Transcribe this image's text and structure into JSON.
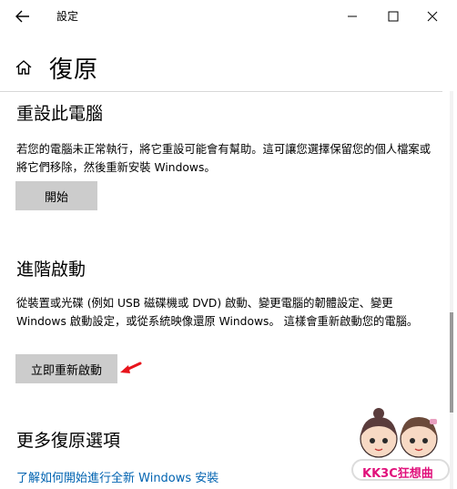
{
  "window": {
    "title": "設定",
    "controls": {
      "minimize": "minimize-icon",
      "maximize": "maximize-icon",
      "close": "close-icon"
    }
  },
  "header": {
    "title": "復原",
    "icon": "home-icon"
  },
  "sections": [
    {
      "title": "重設此電腦",
      "description": "若您的電腦未正常執行，將它重設可能會有幫助。這可讓您選擇保留您的個人檔案或將它們移除，然後重新安裝 Windows。",
      "button": "開始"
    },
    {
      "title": "進階啟動",
      "description": "從裝置或光碟 (例如 USB 磁碟機或 DVD) 啟動、變更電腦的韌體設定、變更 Windows 啟動設定，或從系統映像還原 Windows。 這樣會重新啟動您的電腦。",
      "button": "立即重新啟動"
    },
    {
      "title": "更多復原選項",
      "link": "了解如何開始進行全新 Windows 安裝"
    }
  ],
  "watermark": {
    "text": "KK3C狂想曲"
  },
  "colors": {
    "button_bg": "#cccccc",
    "link": "#0063b1",
    "arrow": "#e8141c",
    "watermark": "#e0117b"
  }
}
